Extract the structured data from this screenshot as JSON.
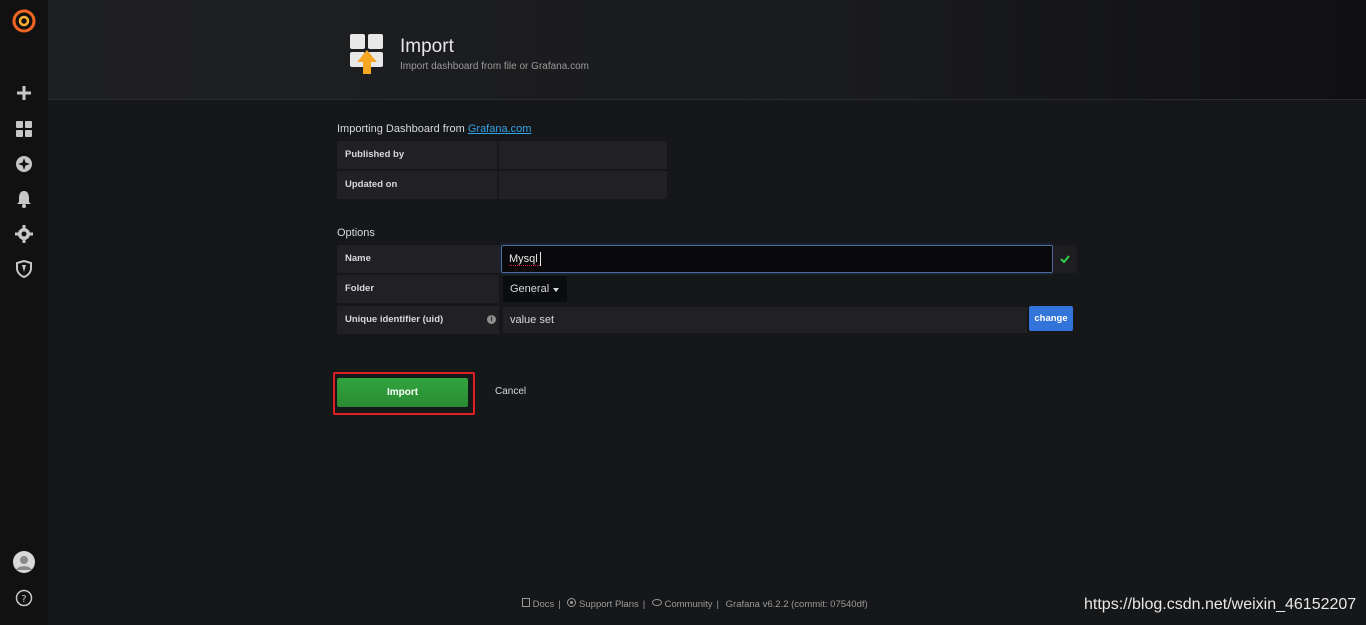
{
  "sidebar": {
    "logo_icon": "grafana-logo",
    "items": [
      {
        "icon": "plus-icon"
      },
      {
        "icon": "dashboards-icon"
      },
      {
        "icon": "explore-icon"
      },
      {
        "icon": "bell-icon"
      },
      {
        "icon": "gear-icon"
      },
      {
        "icon": "shield-icon"
      }
    ],
    "bottom": [
      {
        "icon": "avatar-icon"
      },
      {
        "icon": "help-icon",
        "glyph": "?"
      }
    ]
  },
  "header": {
    "title": "Import",
    "subtitle": "Import dashboard from file or Grafana.com"
  },
  "import_source": {
    "prefix": "Importing Dashboard from ",
    "link": "Grafana.com",
    "rows": [
      {
        "label": "Published by",
        "value": ""
      },
      {
        "label": "Updated on",
        "value": ""
      }
    ]
  },
  "options": {
    "heading": "Options",
    "name_label": "Name",
    "name_value": "Mysql",
    "folder_label": "Folder",
    "folder_value": "General",
    "uid_label": "Unique identifier (uid)",
    "uid_value": "value set",
    "uid_info_glyph": "i",
    "change_label": "change"
  },
  "actions": {
    "import_label": "Import",
    "cancel_label": "Cancel"
  },
  "footer": {
    "docs": "Docs",
    "support": "Support Plans",
    "community": "Community",
    "version": "Grafana v6.2.2 (commit: 07540df)"
  },
  "watermark": "https://blog.csdn.net/weixin_46152207",
  "colors": {
    "accent_blue": "#3274d9",
    "import_green": "#2a9a36",
    "highlight_red": "#e02020",
    "valid_check": "#2ed14d"
  }
}
